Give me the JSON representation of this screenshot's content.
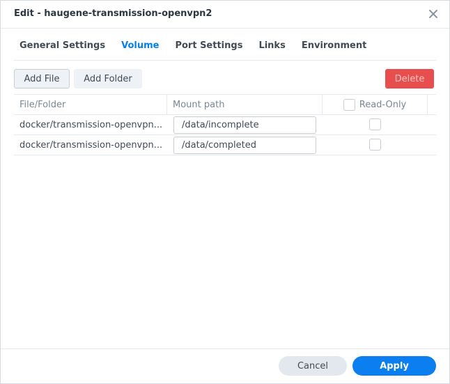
{
  "dialog": {
    "title": "Edit - haugene-transmission-openvpn2"
  },
  "tabs": [
    {
      "label": "General Settings",
      "active": false
    },
    {
      "label": "Volume",
      "active": true
    },
    {
      "label": "Port Settings",
      "active": false
    },
    {
      "label": "Links",
      "active": false
    },
    {
      "label": "Environment",
      "active": false
    }
  ],
  "toolbar": {
    "add_file_label": "Add File",
    "add_folder_label": "Add Folder",
    "delete_label": "Delete"
  },
  "grid": {
    "columns": {
      "file_folder": "File/Folder",
      "mount_path": "Mount path",
      "read_only": "Read-Only"
    },
    "rows": [
      {
        "file_folder": "docker/transmission-openvpn...",
        "mount_path": "/data/incomplete",
        "read_only": false
      },
      {
        "file_folder": "docker/transmission-openvpn...",
        "mount_path": "/data/completed",
        "read_only": false
      }
    ]
  },
  "footer": {
    "cancel_label": "Cancel",
    "apply_label": "Apply"
  },
  "colors": {
    "accent": "#057feb",
    "apply_button": "#0b7ff0",
    "delete_button": "#e94e4e"
  },
  "icons": {
    "close": "close-icon"
  }
}
